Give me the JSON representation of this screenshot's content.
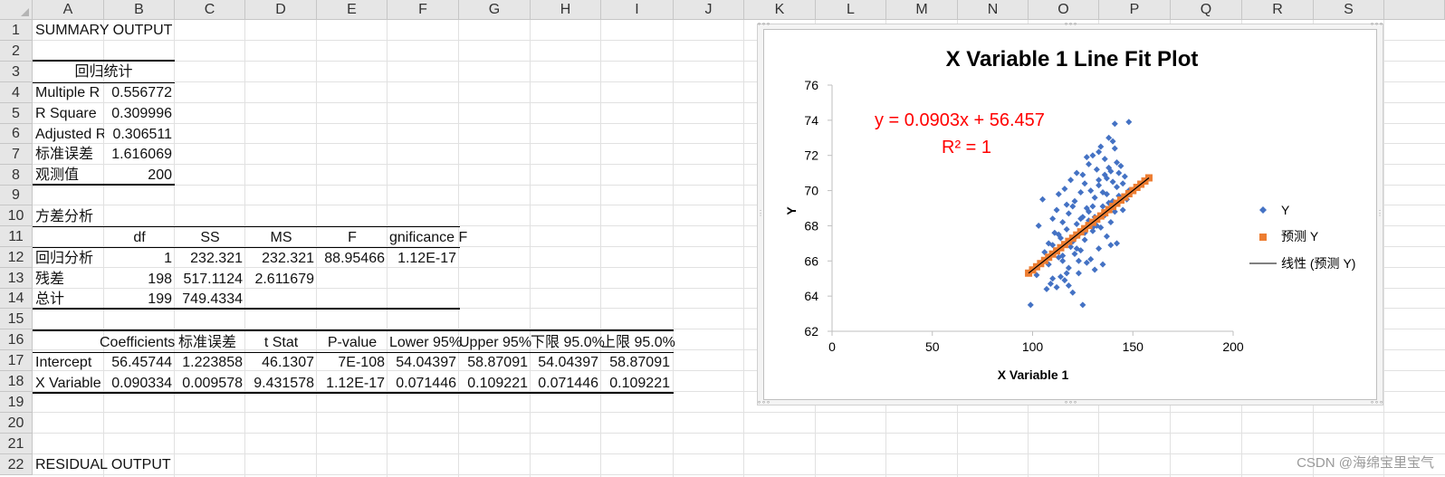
{
  "columns": [
    "A",
    "B",
    "C",
    "D",
    "E",
    "F",
    "G",
    "H",
    "I",
    "J",
    "K",
    "L",
    "M",
    "N",
    "O",
    "P",
    "Q",
    "R",
    "S"
  ],
  "rows": [
    "1",
    "2",
    "3",
    "4",
    "5",
    "6",
    "7",
    "8",
    "9",
    "10",
    "11",
    "12",
    "13",
    "14",
    "15",
    "16",
    "17",
    "18",
    "19",
    "20",
    "21",
    "22"
  ],
  "summary": {
    "title": "SUMMARY OUTPUT",
    "regression_stats_header": "回归统计",
    "stats": [
      {
        "label": "Multiple R",
        "value": "0.556772"
      },
      {
        "label": "R Square",
        "value": "0.309996"
      },
      {
        "label": "Adjusted R",
        "value": "0.306511"
      },
      {
        "label": "标准误差",
        "value": "1.616069"
      },
      {
        "label": "观测值",
        "value": "200"
      }
    ]
  },
  "anova": {
    "title": "方差分析",
    "headers": [
      "df",
      "SS",
      "MS",
      "F",
      "gnificance F"
    ],
    "rows": [
      {
        "label": "回归分析",
        "cells": [
          "1",
          "232.321",
          "232.321",
          "88.95466",
          "1.12E-17"
        ]
      },
      {
        "label": "残差",
        "cells": [
          "198",
          "517.1124",
          "2.611679",
          "",
          ""
        ]
      },
      {
        "label": "总计",
        "cells": [
          "199",
          "749.4334",
          "",
          "",
          ""
        ]
      }
    ]
  },
  "coefficients": {
    "headers": [
      "Coefficients",
      "标准误差",
      "t Stat",
      "P-value",
      "Lower 95%",
      "Upper 95%",
      "下限 95.0%",
      "上限 95.0%"
    ],
    "rows": [
      {
        "label": "Intercept",
        "cells": [
          "56.45744",
          "1.223858",
          "46.1307",
          "7E-108",
          "54.04397",
          "58.87091",
          "54.04397",
          "58.87091"
        ]
      },
      {
        "label": "X Variable",
        "cells": [
          "0.090334",
          "0.009578",
          "9.431578",
          "1.12E-17",
          "0.071446",
          "0.109221",
          "0.071446",
          "0.109221"
        ]
      }
    ]
  },
  "residual_title": "RESIDUAL OUTPUT",
  "chart_data": {
    "type": "scatter",
    "title": "X Variable 1 Line Fit  Plot",
    "xlabel": "X Variable 1",
    "ylabel": "Y",
    "xlim": [
      0,
      200
    ],
    "ylim": [
      62,
      76
    ],
    "xticks": [
      "0",
      "50",
      "100",
      "150",
      "200"
    ],
    "yticks": [
      "62",
      "64",
      "66",
      "68",
      "70",
      "72",
      "74",
      "76"
    ],
    "equation": "y = 0.0903x + 56.457",
    "r_squared": "R² = 1",
    "legend": [
      "Y",
      "预测 Y",
      "线性 (预测 Y)"
    ],
    "legend_position": "right",
    "colors": {
      "y": "#4472C4",
      "pred": "#ED7D31",
      "trend": "#000000",
      "annotation": "#FF0000"
    },
    "trend": {
      "slope": 0.0903,
      "intercept": 56.457
    },
    "series_y": {
      "x": [
        99,
        102,
        103,
        105,
        106,
        107,
        108,
        108,
        109,
        110,
        110,
        111,
        112,
        112,
        113,
        113,
        114,
        114,
        115,
        115,
        116,
        116,
        117,
        117,
        118,
        118,
        119,
        119,
        120,
        120,
        121,
        121,
        122,
        122,
        123,
        123,
        124,
        124,
        125,
        125,
        126,
        126,
        127,
        127,
        128,
        128,
        129,
        129,
        130,
        130,
        131,
        131,
        132,
        132,
        133,
        133,
        134,
        134,
        135,
        135,
        136,
        136,
        137,
        137,
        138,
        138,
        139,
        139,
        140,
        140,
        141,
        141,
        142,
        142,
        143,
        144,
        145,
        146,
        147,
        148,
        121,
        124,
        127,
        130,
        133,
        136,
        139,
        142,
        145,
        110,
        115,
        120,
        125,
        130,
        135,
        140,
        118,
        123,
        128,
        133,
        138,
        113,
        117,
        122,
        126,
        131,
        137,
        141,
        143,
        148
      ],
      "y": [
        63.5,
        65.2,
        68.0,
        69.5,
        66.5,
        64.4,
        67.0,
        65.8,
        64.7,
        68.4,
        66.9,
        67.6,
        64.5,
        68.9,
        66.2,
        69.8,
        65.1,
        67.3,
        68.2,
        66.0,
        70.1,
        64.9,
        67.8,
        69.2,
        65.6,
        68.7,
        66.8,
        70.6,
        67.1,
        64.2,
        69.4,
        66.4,
        68.1,
        71.0,
        65.3,
        67.5,
        69.9,
        66.6,
        68.5,
        63.5,
        70.4,
        67.2,
        65.9,
        69.0,
        71.5,
        68.3,
        66.1,
        70.0,
        67.7,
        72.0,
        65.5,
        69.6,
        68.0,
        71.2,
        66.7,
        70.3,
        67.9,
        72.5,
        69.1,
        65.8,
        71.8,
        68.6,
        70.7,
        67.4,
        73.0,
        69.3,
        71.1,
        66.9,
        70.5,
        72.8,
        68.8,
        73.8,
        70.2,
        67.0,
        69.7,
        71.4,
        68.9,
        70.8,
        69.5,
        70.0,
        67.3,
        68.4,
        71.9,
        69.1,
        72.2,
        70.9,
        68.2,
        71.6,
        70.4,
        65.0,
        66.3,
        69.1,
        70.9,
        67.9,
        69.9,
        69.4,
        64.6,
        66.0,
        68.8,
        70.6,
        71.3,
        67.5,
        65.3,
        66.7,
        67.6,
        68.5,
        69.8,
        72.4,
        71.0,
        73.9
      ]
    },
    "series_pred": {
      "x": [
        98,
        100,
        102,
        104,
        106,
        108,
        110,
        112,
        114,
        116,
        118,
        120,
        122,
        124,
        126,
        128,
        130,
        132,
        134,
        136,
        138,
        140,
        142,
        144,
        146,
        148,
        150,
        152,
        154,
        156,
        158
      ]
    }
  }
}
